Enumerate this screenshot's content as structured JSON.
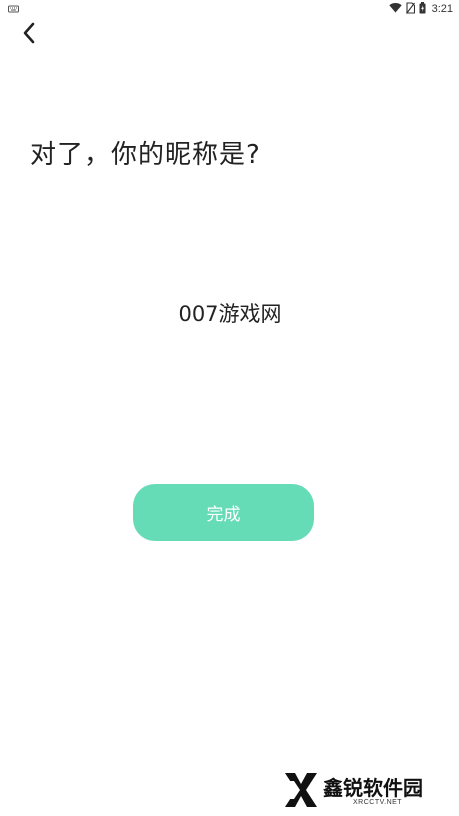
{
  "status_bar": {
    "time": "3:21",
    "icons": [
      "keyboard-icon",
      "wifi-icon",
      "no-sim-icon",
      "battery-icon"
    ]
  },
  "header": {
    "back_icon": "chevron-left-icon"
  },
  "question": {
    "title": "对了，你的昵称是?"
  },
  "nickname_input": {
    "value": "007游戏网"
  },
  "done_button": {
    "label": "完成",
    "color": "#66dcb6"
  },
  "watermark": {
    "name": "鑫锐软件园",
    "domain": "XRCCTV.NET"
  }
}
